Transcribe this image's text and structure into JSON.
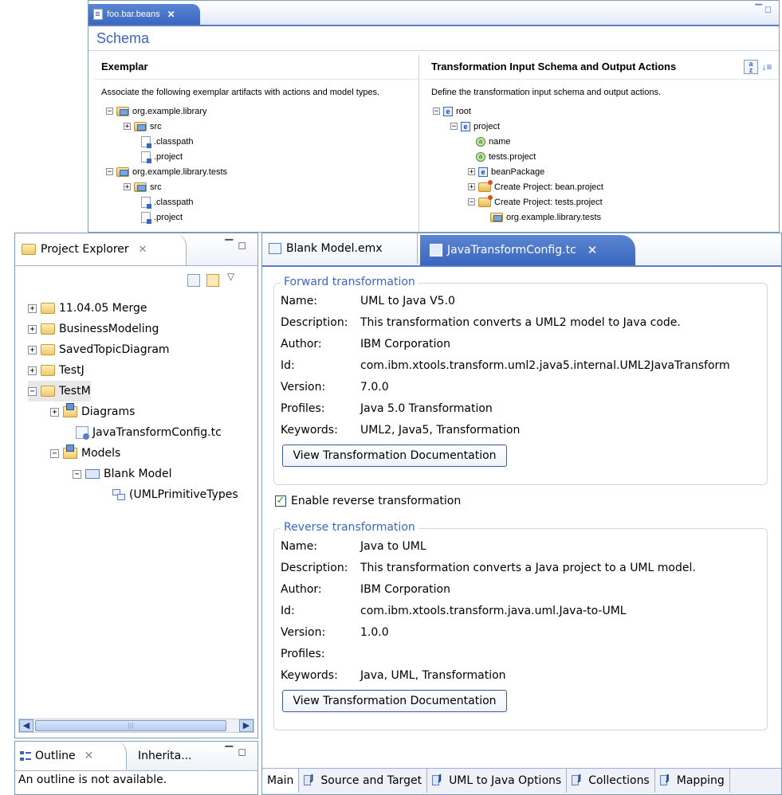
{
  "schema_editor": {
    "tab_title": "foo.bar.beans",
    "heading": "Schema",
    "exemplar": {
      "title": "Exemplar",
      "description": "Associate the following exemplar artifacts with actions and model types.",
      "tree": [
        "org.example.library",
        "src",
        ".classpath",
        ".project",
        "org.example.library.tests",
        "src",
        ".classpath",
        ".project"
      ]
    },
    "transform": {
      "title": "Transformation Input Schema and Output Actions",
      "description": "Define the transformation input schema and output actions.",
      "tree": [
        "root",
        "project",
        "name",
        "tests.project",
        "beanPackage",
        "Create Project: bean.project",
        "Create Project: tests.project",
        "org.example.library.tests"
      ]
    }
  },
  "project_explorer": {
    "title": "Project Explorer",
    "tree": [
      "11.04.05 Merge",
      "BusinessModeling",
      "SavedTopicDiagram",
      "TestJ",
      "TestM",
      "Diagrams",
      "JavaTransformConfig.tc",
      "Models",
      "Blank Model",
      "(UMLPrimitiveTypes"
    ]
  },
  "outline": {
    "tab1": "Outline",
    "tab2": "Inherita...",
    "message": "An outline is not available."
  },
  "editor": {
    "tabs": [
      "Blank Model.emx",
      "JavaTransformConfig.tc"
    ],
    "forward": {
      "title": "Forward transformation",
      "props": [
        {
          "k": "Name:",
          "v": "UML to Java V5.0"
        },
        {
          "k": "Description:",
          "v": "This transformation converts a UML2 model to Java code."
        },
        {
          "k": "Author:",
          "v": "IBM Corporation"
        },
        {
          "k": "Id:",
          "v": "com.ibm.xtools.transform.uml2.java5.internal.UML2JavaTransform"
        },
        {
          "k": "Version:",
          "v": "7.0.0"
        },
        {
          "k": "Profiles:",
          "v": "Java 5.0 Transformation"
        },
        {
          "k": "Keywords:",
          "v": "UML2, Java5, Transformation"
        }
      ],
      "button": "View Transformation Documentation"
    },
    "enable_reverse_label": "Enable reverse transformation",
    "enable_reverse_checked": true,
    "reverse": {
      "title": "Reverse transformation",
      "props": [
        {
          "k": "Name:",
          "v": "Java to UML"
        },
        {
          "k": "Description:",
          "v": "This transformation converts a Java project to a UML model."
        },
        {
          "k": "Author:",
          "v": "IBM Corporation"
        },
        {
          "k": "Id:",
          "v": "com.ibm.xtools.transform.java.uml.Java-to-UML"
        },
        {
          "k": "Version:",
          "v": "1.0.0"
        },
        {
          "k": "Profiles:",
          "v": ""
        },
        {
          "k": "Keywords:",
          "v": "Java, UML, Transformation"
        }
      ],
      "button": "View Transformation Documentation"
    },
    "bottom_tabs": [
      "Main",
      "Source and Target",
      "UML to Java Options",
      "Collections",
      "Mapping"
    ]
  }
}
